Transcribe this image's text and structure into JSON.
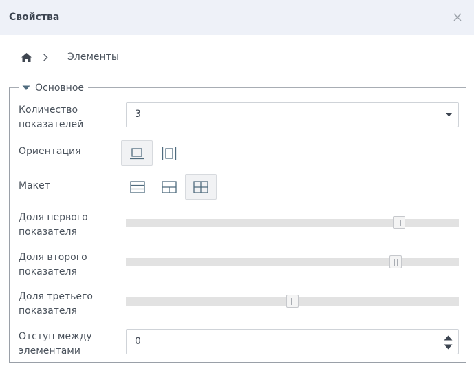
{
  "panel": {
    "title": "Свойства",
    "close_icon": "close-icon"
  },
  "breadcrumb": {
    "home_icon": "home-icon",
    "separator_icon": "chevron-right-icon",
    "current": "Элементы"
  },
  "section": {
    "legend": "Основное",
    "expanded": true
  },
  "fields": {
    "indicator_count": {
      "label": "Количество показателей",
      "value": "3"
    },
    "orientation": {
      "label": "Ориентация",
      "options": [
        "horizontal",
        "vertical"
      ],
      "selected": "horizontal"
    },
    "layout": {
      "label": "Макет",
      "options": [
        "rows",
        "split",
        "grid"
      ],
      "selected": "grid"
    },
    "first_share": {
      "label": "Доля первого показателя",
      "fraction": 0.82
    },
    "second_share": {
      "label": "Доля второго показателя",
      "fraction": 0.81
    },
    "third_share": {
      "label": "Доля третьего показателя",
      "fraction": 0.5
    },
    "spacing": {
      "label": "Отступ между элементами",
      "value": "0"
    }
  },
  "colors": {
    "header_bg": "#eef1f8",
    "slider_track": "#e2e2e2",
    "icon": "#4f6b7e"
  }
}
